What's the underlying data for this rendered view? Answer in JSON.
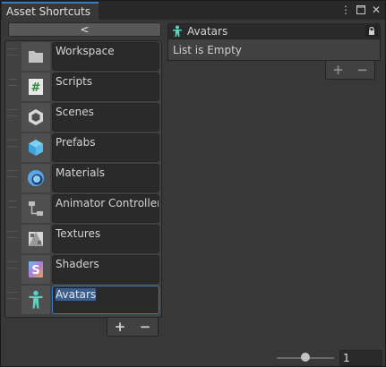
{
  "window": {
    "tab_title": "Asset Shortcuts",
    "controls": [
      "more-icon",
      "maximize-icon",
      "close-icon"
    ]
  },
  "left": {
    "collapse_label": "<",
    "items": [
      {
        "label": "Workspace",
        "icon": "folder-icon"
      },
      {
        "label": "Scripts",
        "icon": "script-icon"
      },
      {
        "label": "Scenes",
        "icon": "scene-icon"
      },
      {
        "label": "Prefabs",
        "icon": "prefab-icon"
      },
      {
        "label": "Materials",
        "icon": "material-icon"
      },
      {
        "label": "Animator Controllers",
        "icon": "animator-icon"
      },
      {
        "label": "Textures",
        "icon": "texture-icon"
      },
      {
        "label": "Shaders",
        "icon": "shader-icon"
      },
      {
        "label": "Avatars",
        "icon": "avatar-icon",
        "selected": true
      }
    ],
    "add_label": "+",
    "remove_label": "−"
  },
  "right": {
    "header": "Avatars",
    "empty_text": "List is Empty",
    "add_label": "+",
    "remove_label": "−"
  },
  "footer": {
    "zoom_value": "1",
    "slider_fraction": 0.5
  }
}
